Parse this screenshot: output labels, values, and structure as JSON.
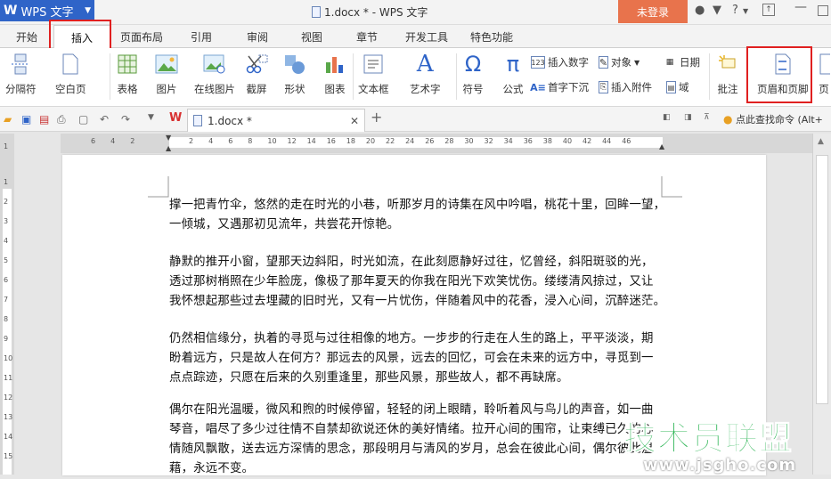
{
  "titlebar": {
    "app_name": "WPS 文字",
    "document_title": "1.docx * - WPS 文字",
    "login_label": "未登录",
    "help_label": "?"
  },
  "tabs": [
    "开始",
    "插入",
    "页面布局",
    "引用",
    "审阅",
    "视图",
    "章节",
    "开发工具",
    "特色功能"
  ],
  "active_tab": "插入",
  "toolbar": {
    "tools": [
      {
        "label": "分隔符",
        "icon": "page-break-icon"
      },
      {
        "label": "空白页",
        "icon": "blank-page-icon"
      },
      {
        "label": "表格",
        "icon": "table-icon"
      },
      {
        "label": "图片",
        "icon": "picture-icon"
      },
      {
        "label": "在线图片",
        "icon": "online-picture-icon"
      },
      {
        "label": "截屏",
        "icon": "screenshot-icon"
      },
      {
        "label": "形状",
        "icon": "shapes-icon"
      },
      {
        "label": "图表",
        "icon": "chart-icon"
      },
      {
        "label": "文本框",
        "icon": "textbox-icon"
      },
      {
        "label": "艺术字",
        "icon": "wordart-icon"
      },
      {
        "label": "符号",
        "icon": "symbol-omega-icon"
      },
      {
        "label": "公式",
        "icon": "formula-pi-icon"
      },
      {
        "label": "批注",
        "icon": "comment-icon"
      },
      {
        "label": "页眉和页脚",
        "icon": "header-footer-icon"
      },
      {
        "label": "页",
        "icon": "page-icon"
      }
    ],
    "small_tools": [
      {
        "label": "插入数字",
        "icon": "number-icon"
      },
      {
        "label": "对象",
        "icon": "object-icon"
      },
      {
        "label": "日期",
        "icon": "date-icon"
      },
      {
        "label": "首字下沉",
        "icon": "drop-cap-icon"
      },
      {
        "label": "插入附件",
        "icon": "attachment-icon"
      },
      {
        "label": "域",
        "icon": "field-icon"
      }
    ]
  },
  "quickbar": {
    "doc_tab": "1.docx *",
    "search_placeholder": "点此查找命令 (Alt+"
  },
  "ruler": {
    "h_labels": [
      "6",
      "4",
      "2",
      "2",
      "4",
      "6",
      "8",
      "10",
      "12",
      "14",
      "16",
      "18",
      "20",
      "22",
      "24",
      "26",
      "28",
      "30",
      "32",
      "34",
      "36",
      "38",
      "40",
      "42",
      "44",
      "46"
    ],
    "v_labels": [
      "1",
      "1",
      "2",
      "3",
      "4",
      "5",
      "6",
      "7",
      "8",
      "9",
      "10",
      "11",
      "12",
      "13",
      "14",
      "15"
    ]
  },
  "document": {
    "paragraphs": [
      [
        "撑一把青竹伞，悠然的走在时光的小巷，听那岁月的诗集在风中吟唱，桃花十里，回眸一望，",
        "一倾城，又遇那初见流年，共尝花开惊艳。"
      ],
      [
        "静默的推开小窗，望那天边斜阳，时光如流，在此刻愿静好过往，忆曾经，斜阳斑驳的光，",
        "透过那树梢照在少年脸庞，像极了那年夏天的你我在阳光下欢笑忧伤。缕缕清风掠过，又让",
        "我怀想起那些过去埋藏的旧时光，又有一片忧伤，伴随着风中的花香，浸入心间，沉醉迷茫。"
      ],
      [
        "仍然相信缘分，执着的寻觅与过往相像的地方。一步步的行走在人生的路上，平平淡淡，期",
        "盼着远方，只是故人在何方？那远去的风景，远去的回忆，可会在未来的远方中，寻觅到一",
        "点点踪迹，只愿在后来的久别重逢里，那些风景，那些故人，都不再缺席。"
      ],
      [
        "偶尔在阳光温暖，微风和煦的时候停留，轻轻的闭上眼睛，聆听着风与鸟儿的声音，如一曲",
        "琴音，唱尽了多少过往情不自禁却欲说还休的美好情绪。拉开心间的围帘，让束缚已久的心",
        "情随风飘散，送去远方深情的思念，那段明月与清风的岁月，总会在彼此心间，偶尔彼此温",
        "藉，永远不变。"
      ]
    ]
  },
  "watermark": {
    "main": "技术员联盟",
    "url": "www.jsgho.com"
  },
  "colors": {
    "app_blue": "#2f64c8",
    "login_orange": "#e8734c",
    "highlight_red": "#e02020",
    "watermark_green": "#22b14c"
  }
}
